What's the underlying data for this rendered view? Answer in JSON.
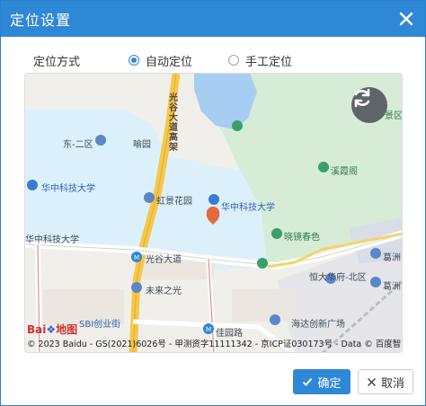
{
  "dialog": {
    "title": "定位设置"
  },
  "location_mode": {
    "label": "定位方式",
    "options": [
      {
        "label": "自动定位",
        "selected": true
      },
      {
        "label": "手工定位",
        "selected": false
      }
    ]
  },
  "map": {
    "labels": {
      "guanggu_viaduct": "光谷大道高架",
      "east2": "东-二区",
      "yuyuan": "喻园",
      "hust_left": "华中科技大学",
      "hongjing": "虹景花园",
      "hust_center": "华中科技大学",
      "hust_bottom": "华中科技大学",
      "guanggu_road": "光谷大道",
      "weilai": "未来之光",
      "sbi": "SBI创业街",
      "jiayuan": "佳园路",
      "xiaojing": "晓镜春色",
      "xiping": "溪霞阁",
      "jingqu": "景区",
      "hengda": "恒大华府-北区",
      "haiyi": "海达创新广场",
      "gezhou_top": "葛洲",
      "gezhou_bottom": "葛洲"
    },
    "baidu_logo": "Bai",
    "baidu_logo_suffix": "地图",
    "copyright": "© 2023 Baidu - GS(2021)6026号 - 甲测资字11111342 - 京ICP证030173号 - Data © 百度智图",
    "refresh_icon": "refresh-icon",
    "marker_icon": "map-pin-icon"
  },
  "footer": {
    "ok_label": "确定",
    "cancel_label": "取消"
  },
  "colors": {
    "accent": "#2f88d6",
    "campus_blue": "#ddeff8",
    "green_area": "#d8ecd9",
    "water": "#a9cdf2",
    "road_yellow": "#f5c84c",
    "marker": "#e46a3c"
  }
}
